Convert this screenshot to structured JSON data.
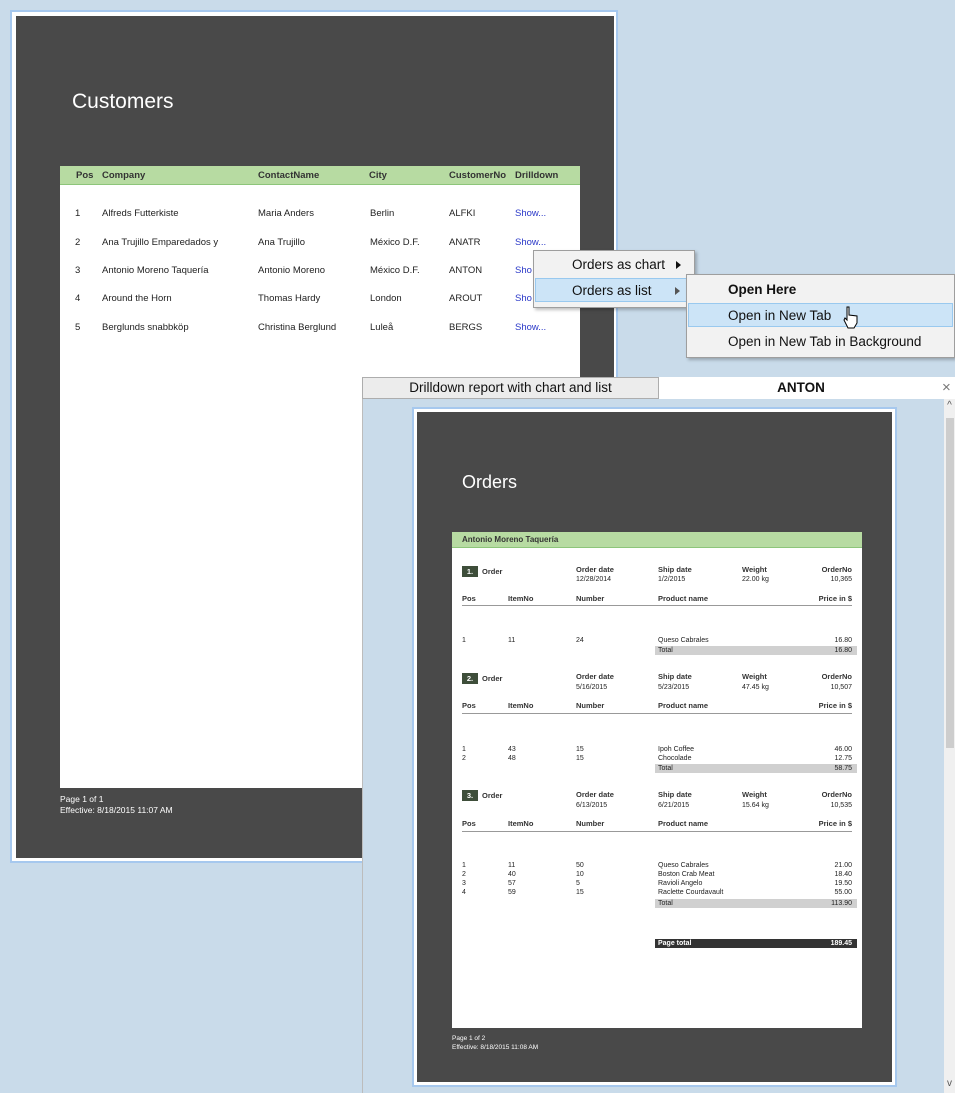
{
  "customers": {
    "title": "Customers",
    "columns": [
      "Pos",
      "Company",
      "ContactName",
      "City",
      "CustomerNo",
      "Drilldown"
    ],
    "rows": [
      {
        "pos": "1",
        "company": "Alfreds Futterkiste",
        "contact": "Maria Anders",
        "city": "Berlin",
        "no": "ALFKI",
        "link": "Show..."
      },
      {
        "pos": "2",
        "company": "Ana Trujillo Emparedados y",
        "contact": "Ana Trujillo",
        "city": "México D.F.",
        "no": "ANATR",
        "link": "Show..."
      },
      {
        "pos": "3",
        "company": "Antonio Moreno Taquería",
        "contact": "Antonio Moreno",
        "city": "México D.F.",
        "no": "ANTON",
        "link": "Sho"
      },
      {
        "pos": "4",
        "company": "Around the Horn",
        "contact": "Thomas Hardy",
        "city": "London",
        "no": "AROUT",
        "link": "Sho"
      },
      {
        "pos": "5",
        "company": "Berglunds snabbköp",
        "contact": "Christina Berglund",
        "city": "Luleå",
        "no": "BERGS",
        "link": "Show..."
      }
    ],
    "footer_page": "Page 1 of 1",
    "footer_effective": "Effective: 8/18/2015 11:07 AM"
  },
  "context_menu": {
    "items": [
      "Orders as chart",
      "Orders as list"
    ]
  },
  "submenu": {
    "open_here": "Open Here",
    "open_new_tab": "Open in New Tab",
    "open_new_tab_bg": "Open in New Tab in Background"
  },
  "tabs": {
    "tab1": "Drilldown report with chart and list",
    "tab2": "ANTON",
    "close": "×"
  },
  "orders": {
    "title": "Orders",
    "customer": "Antonio Moreno Taquería",
    "col_order_date": "Order date",
    "col_ship_date": "Ship date",
    "col_weight": "Weight",
    "col_orderno": "OrderNo",
    "col_pos": "Pos",
    "col_itemno": "ItemNo",
    "col_number": "Number",
    "col_product": "Product name",
    "col_price": "Price in $",
    "order_label": "Order",
    "total_label": "Total",
    "blocks": [
      {
        "num": "1.",
        "order_date": "12/28/2014",
        "ship_date": "1/2/2015",
        "weight": "22.00 kg",
        "orderno": "10,365",
        "items": [
          {
            "pos": "1",
            "item": "11",
            "number": "24",
            "product": "Queso Cabrales",
            "price": "16.80"
          }
        ],
        "total": "16.80"
      },
      {
        "num": "2.",
        "order_date": "5/16/2015",
        "ship_date": "5/23/2015",
        "weight": "47.45 kg",
        "orderno": "10,507",
        "items": [
          {
            "pos": "1",
            "item": "43",
            "number": "15",
            "product": "Ipoh Coffee",
            "price": "46.00"
          },
          {
            "pos": "2",
            "item": "48",
            "number": "15",
            "product": "Chocolade",
            "price": "12.75"
          }
        ],
        "total": "58.75"
      },
      {
        "num": "3.",
        "order_date": "6/13/2015",
        "ship_date": "6/21/2015",
        "weight": "15.64 kg",
        "orderno": "10,535",
        "items": [
          {
            "pos": "1",
            "item": "11",
            "number": "50",
            "product": "Queso Cabrales",
            "price": "21.00"
          },
          {
            "pos": "2",
            "item": "40",
            "number": "10",
            "product": "Boston Crab Meat",
            "price": "18.40"
          },
          {
            "pos": "3",
            "item": "57",
            "number": "5",
            "product": "Ravioli Angelo",
            "price": "19.50"
          },
          {
            "pos": "4",
            "item": "59",
            "number": "15",
            "product": "Raclette Courdavault",
            "price": "55.00"
          }
        ],
        "total": "113.90"
      }
    ],
    "page_total_label": "Page total",
    "page_total": "189.45",
    "footer_page": "Page 1 of 2",
    "footer_effective": "Effective: 8/18/2015 11:08 AM"
  }
}
